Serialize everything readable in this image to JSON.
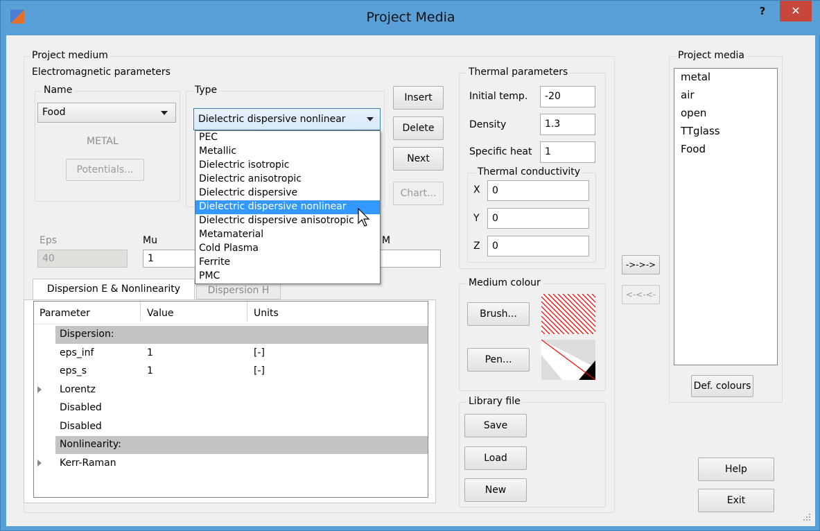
{
  "window": {
    "title": "Project Media",
    "help_glyph": "?",
    "close_glyph": "✕"
  },
  "project_medium": {
    "title": "Project medium",
    "em_params": {
      "title": "Electromagnetic parameters",
      "name_group": "Name",
      "name_value": "Food",
      "type_group": "Type",
      "type_value": "Dielectric dispersive nonlinear",
      "type_options": [
        "PEC",
        "Metallic",
        "Dielectric isotropic",
        "Dielectric anisotropic",
        "Dielectric dispersive",
        "Dielectric dispersive nonlinear",
        "Dielectric dispersive anisotropic",
        "Metamaterial",
        "Cold Plasma",
        "Ferrite",
        "PMC"
      ],
      "type_selected_index": 5,
      "metal_label": "METAL",
      "potentials_button": "Potentials...",
      "eps_label": "Eps",
      "eps_value": "40",
      "mu_label": "Mu",
      "mu_value": "1",
      "m_label": "M",
      "m_value": ""
    },
    "buttons": {
      "insert": "Insert",
      "delete": "Delete",
      "next": "Next",
      "chart": "Chart..."
    },
    "tabs": [
      {
        "label": "Dispersion E & Nonlinearity"
      },
      {
        "label": "Dispersion H"
      }
    ],
    "tree": {
      "headers": [
        "Parameter",
        "Value",
        "Units"
      ],
      "rows": [
        {
          "param": "Dispersion:",
          "value": "",
          "units": "",
          "band": true,
          "expander": false
        },
        {
          "param": "eps_inf",
          "value": "1",
          "units": "[-]",
          "band": false,
          "expander": false
        },
        {
          "param": "eps_s",
          "value": "1",
          "units": "[-]",
          "band": false,
          "expander": false
        },
        {
          "param": "Lorentz",
          "value": "",
          "units": "",
          "band": false,
          "expander": true
        },
        {
          "param": "Disabled",
          "value": "",
          "units": "",
          "band": false,
          "expander": false
        },
        {
          "param": "Disabled",
          "value": "",
          "units": "",
          "band": false,
          "expander": false
        },
        {
          "param": "Nonlinearity:",
          "value": "",
          "units": "",
          "band": true,
          "expander": false
        },
        {
          "param": "Kerr-Raman",
          "value": "",
          "units": "",
          "band": false,
          "expander": true
        }
      ]
    }
  },
  "thermal": {
    "title": "Thermal parameters",
    "initial_temp_label": "Initial temp.",
    "initial_temp_value": "-20",
    "density_label": "Density",
    "density_value": "1.3",
    "specific_heat_label": "Specific heat",
    "specific_heat_value": "1",
    "conductivity_title": "Thermal conductivity",
    "x_label": "X",
    "x_value": "0",
    "y_label": "Y",
    "y_value": "0",
    "z_label": "Z",
    "z_value": "0"
  },
  "medium_colour": {
    "title": "Medium colour",
    "brush_button": "Brush...",
    "pen_button": "Pen...",
    "brush_color": "#ff0000",
    "pen_color": "#ff0000"
  },
  "library_file": {
    "title": "Library file",
    "save": "Save",
    "load": "Load",
    "new": "New"
  },
  "transfer": {
    "to_right": "->->->",
    "to_left": "<-<-<-"
  },
  "project_media": {
    "title": "Project media",
    "items": [
      "metal",
      "air",
      "open",
      "TTglass",
      "Food"
    ]
  },
  "footer": {
    "def_colours": "Def. colours",
    "help": "Help",
    "exit": "Exit"
  }
}
